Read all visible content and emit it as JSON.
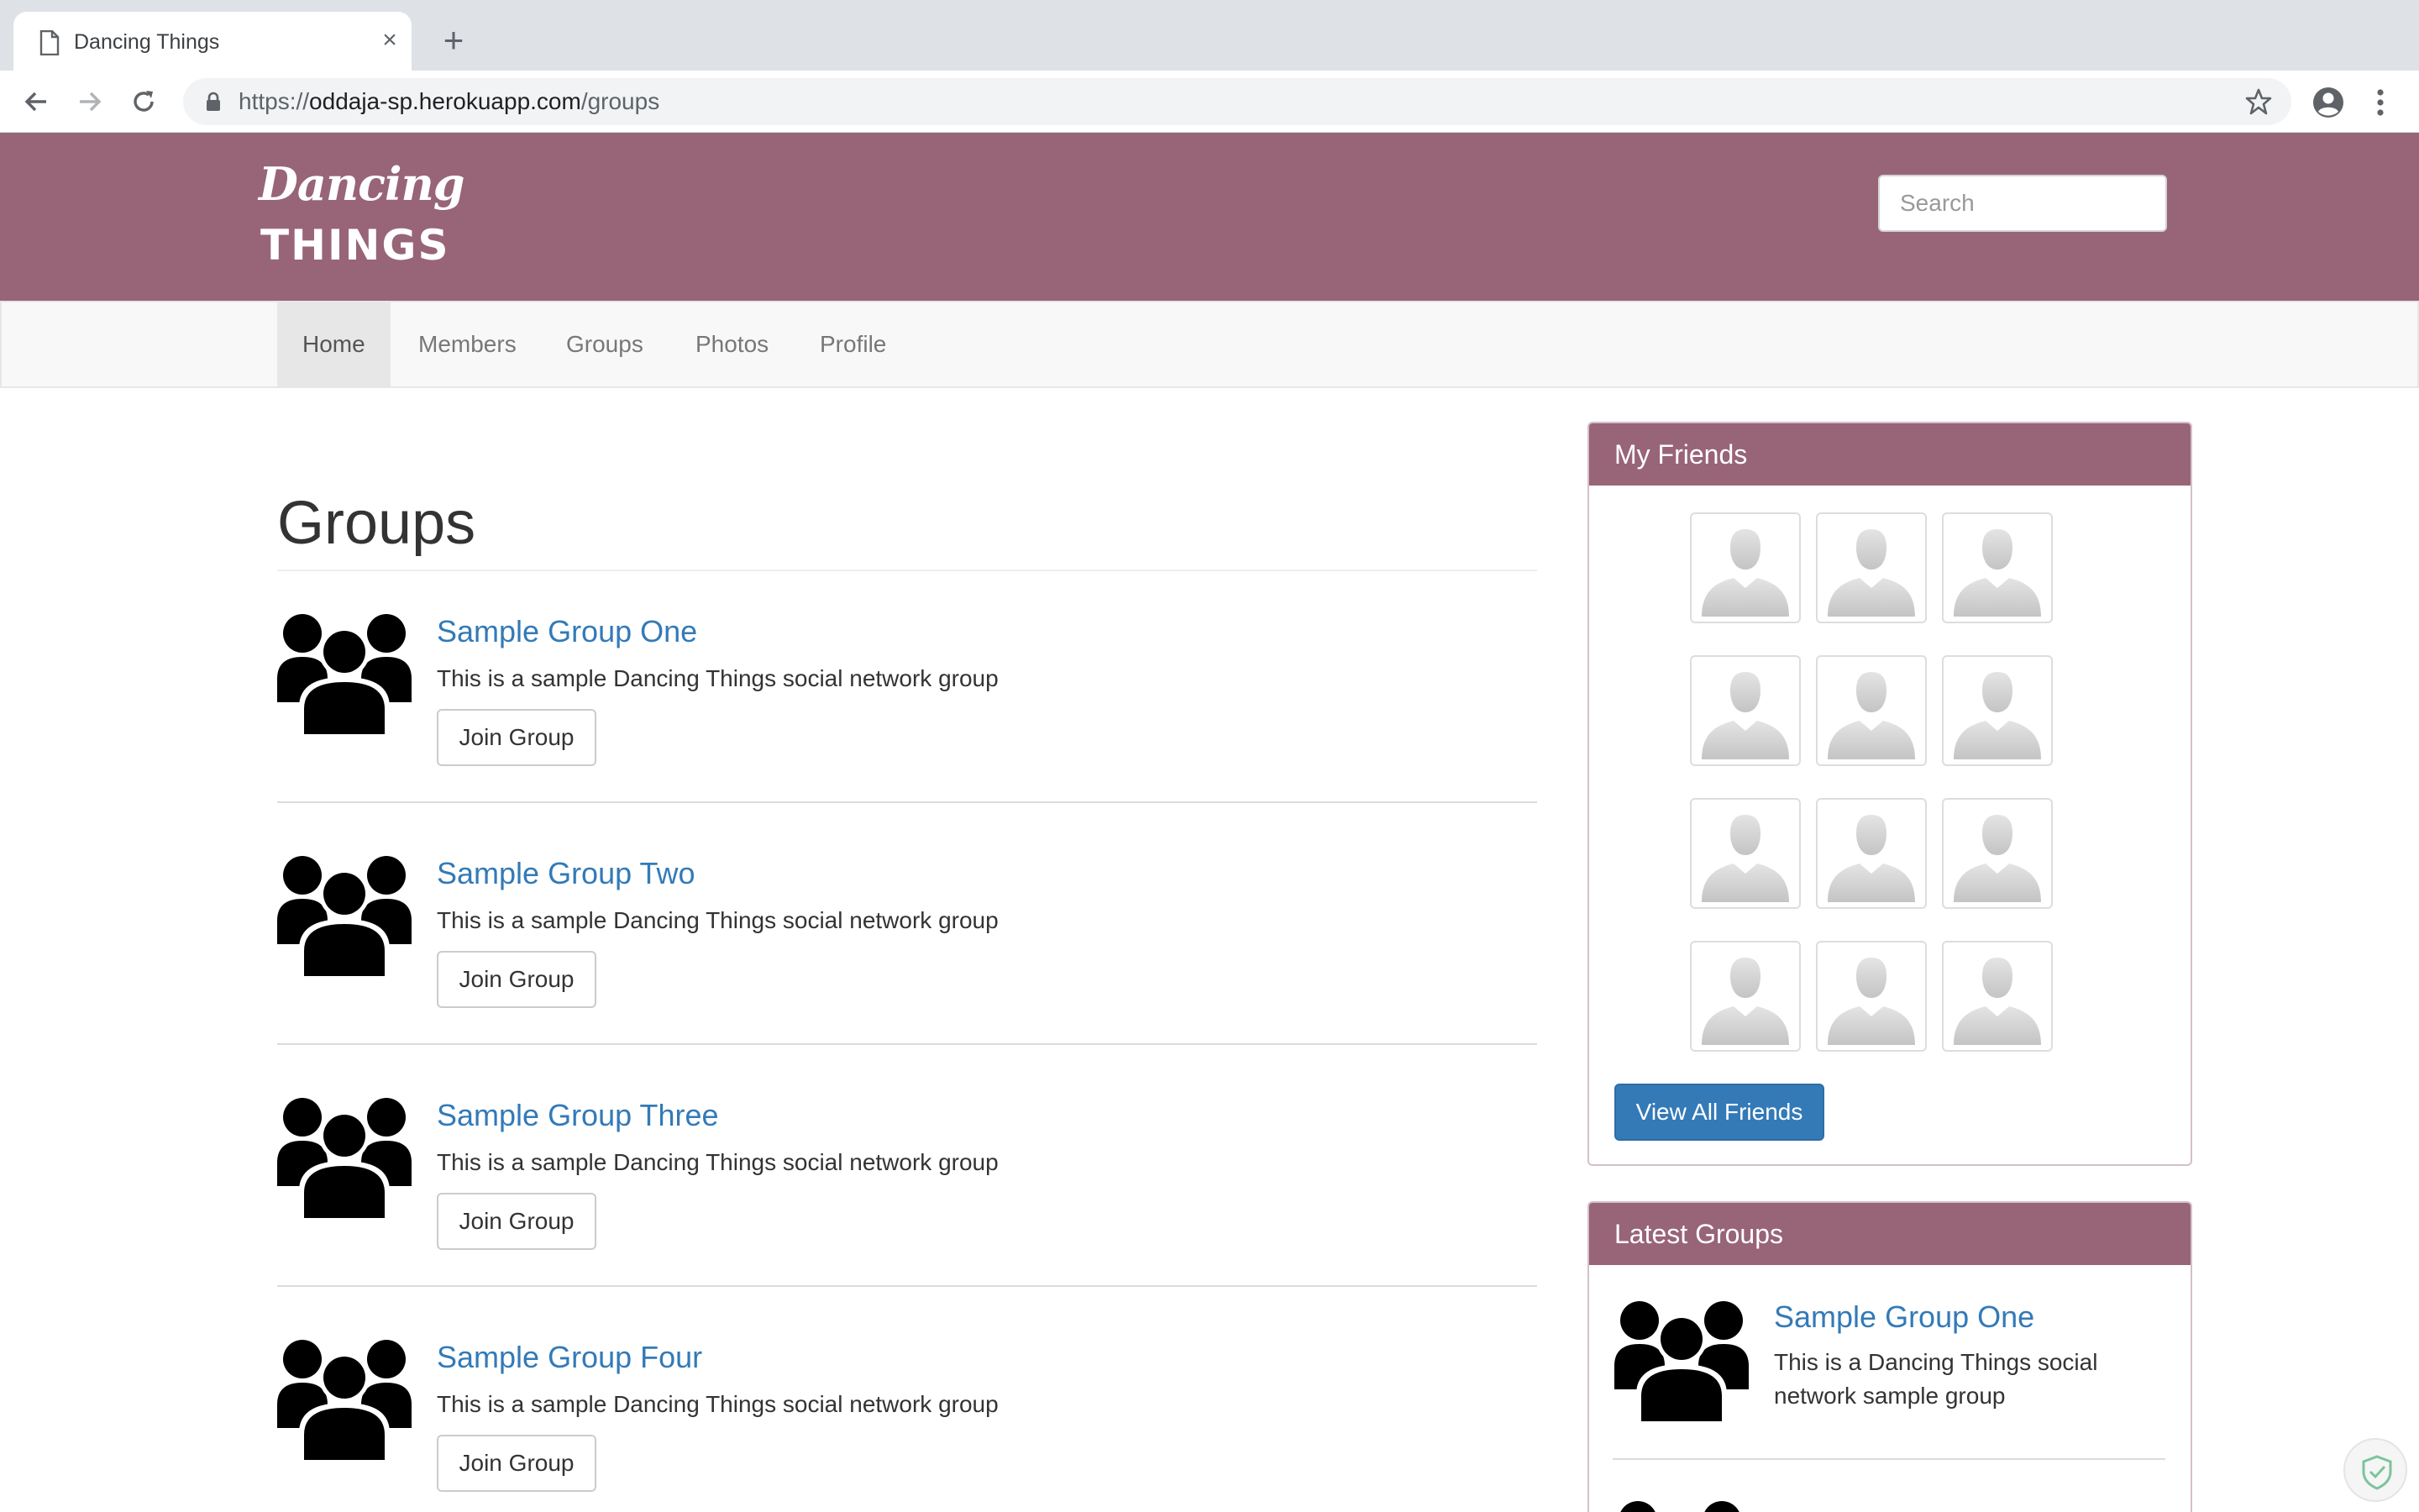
{
  "browser": {
    "tab_title": "Dancing Things",
    "url_scheme": "https://",
    "url_host": "oddaja-sp.herokuapp.com",
    "url_path": "/groups"
  },
  "site": {
    "logo_line1": "Dancing",
    "logo_line2": "THINGS",
    "search_placeholder": "Search",
    "brand_color": "#986478",
    "link_color": "#337ab7"
  },
  "nav": {
    "items": [
      {
        "label": "Home",
        "active": true
      },
      {
        "label": "Members",
        "active": false
      },
      {
        "label": "Groups",
        "active": false
      },
      {
        "label": "Photos",
        "active": false
      },
      {
        "label": "Profile",
        "active": false
      }
    ]
  },
  "main": {
    "title": "Groups",
    "groups": [
      {
        "name": "Sample Group One",
        "description": "This is a sample Dancing Things social network group",
        "button": "Join Group"
      },
      {
        "name": "Sample Group Two",
        "description": "This is a sample Dancing Things social network group",
        "button": "Join Group"
      },
      {
        "name": "Sample Group Three",
        "description": "This is a sample Dancing Things social network group",
        "button": "Join Group"
      },
      {
        "name": "Sample Group Four",
        "description": "This is a sample Dancing Things social network group",
        "button": "Join Group"
      }
    ]
  },
  "sidebar": {
    "friends": {
      "heading": "My Friends",
      "button": "View All Friends"
    },
    "latest": {
      "heading": "Latest Groups",
      "items": [
        {
          "name": "Sample Group One",
          "description": "This is a Dancing Things social network sample group"
        }
      ]
    }
  }
}
